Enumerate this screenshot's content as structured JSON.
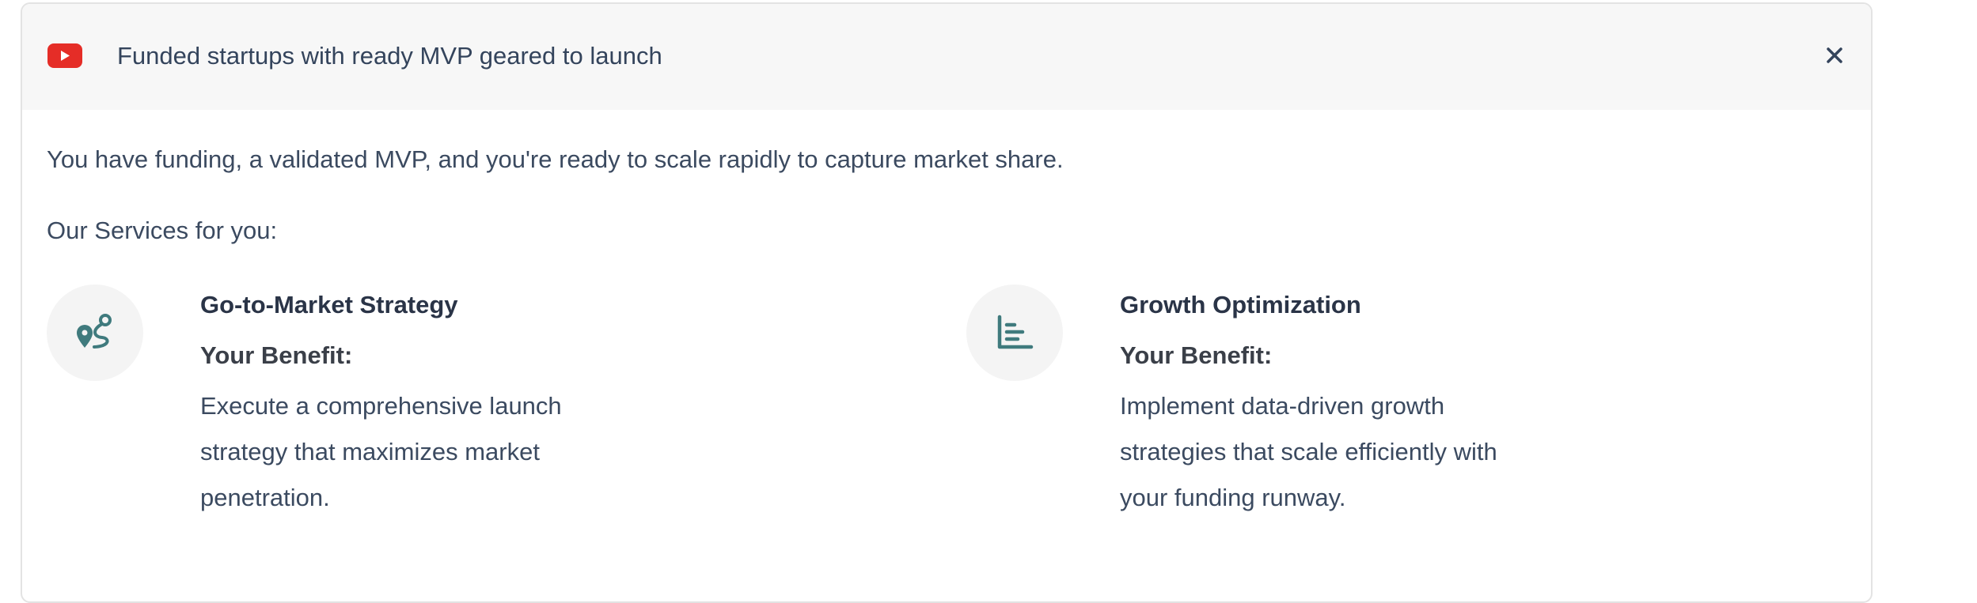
{
  "header": {
    "title": "Funded startups with ready MVP geared to launch",
    "icon": "youtube-icon",
    "close_icon": "close-icon"
  },
  "intro": "You have funding, a validated MVP, and you're ready to scale rapidly to capture market share.",
  "services_heading": "Our Services for you:",
  "services": [
    {
      "title": "Go-to-Market Strategy",
      "benefit_label": "Your Benefit:",
      "description": "Execute a comprehensive launch strategy that maximizes market penetration.",
      "icon": "route-icon"
    },
    {
      "title": "Growth Optimization",
      "benefit_label": "Your Benefit:",
      "description": "Implement data-driven growth strategies that scale efficiently with your funding runway.",
      "icon": "bar-chart-icon"
    }
  ],
  "colors": {
    "accent": "#3f7a7d",
    "youtube_red": "#e52d27",
    "header_bg": "#f7f7f7",
    "text": "#3b4a60"
  }
}
